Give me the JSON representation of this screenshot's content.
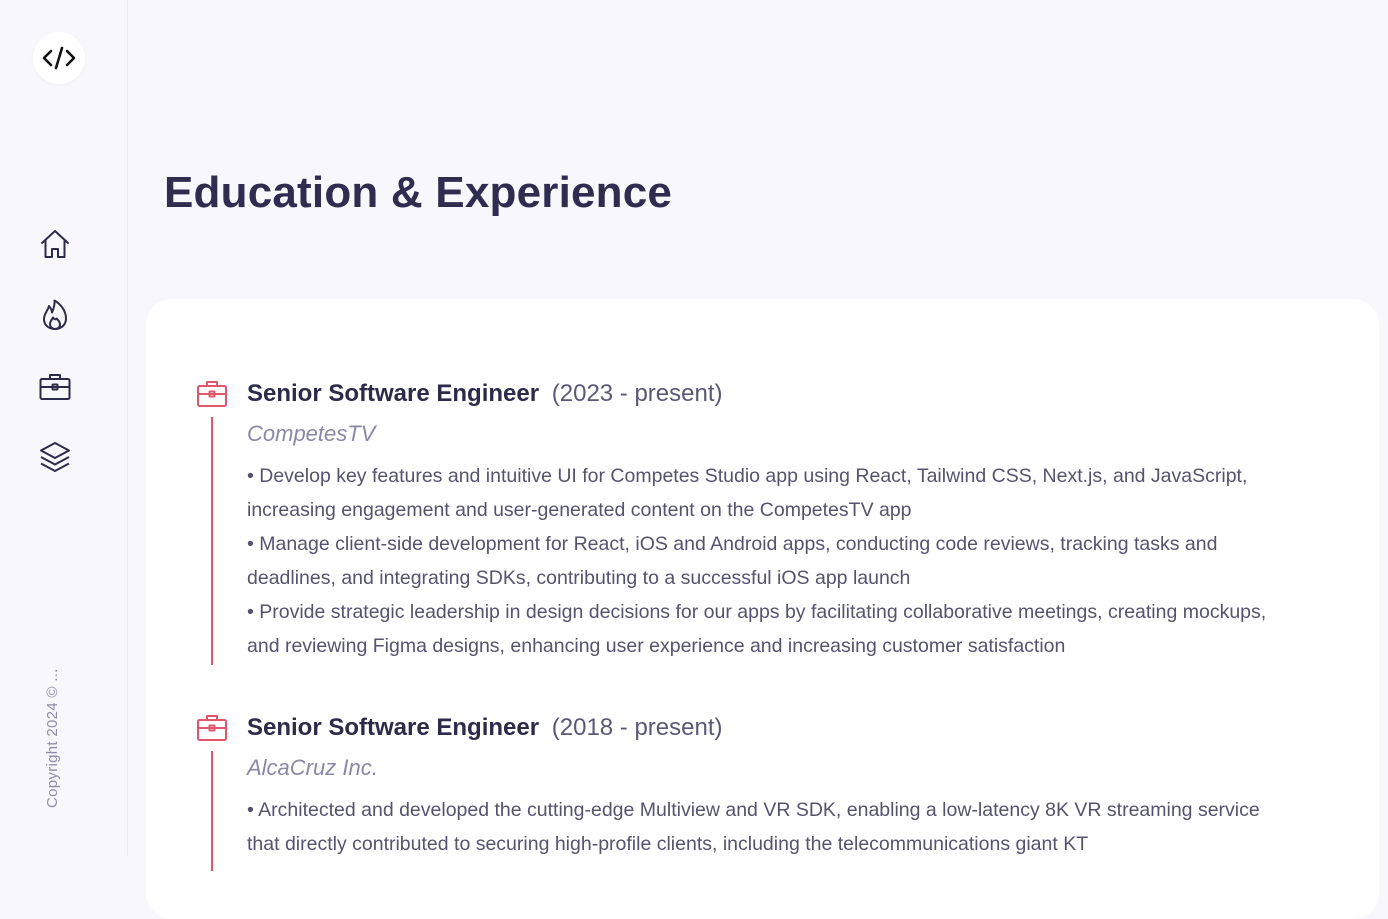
{
  "sidebar": {
    "logo_icon": "code-brackets-icon",
    "nav": [
      {
        "name": "home",
        "icon": "home-icon"
      },
      {
        "name": "flame",
        "icon": "flame-icon"
      },
      {
        "name": "briefcase",
        "icon": "briefcase-icon"
      },
      {
        "name": "layers",
        "icon": "layers-icon"
      }
    ],
    "copyright": "Copyright 2024 © ..."
  },
  "page": {
    "title": "Education & Experience"
  },
  "colors": {
    "accent": "#e0566a",
    "title": "#2f2c4f",
    "muted": "#8a88a6",
    "background": "#f8f7fc",
    "card": "#ffffff"
  },
  "experience": [
    {
      "role": "Senior Software Engineer",
      "period": "(2023 - present)",
      "company": "CompetesTV",
      "bullets": [
        "• Develop key features and intuitive UI for Competes Studio app using React, Tailwind CSS, Next.js, and JavaScript, increasing engagement and user-generated content on the CompetesTV app",
        "• Manage client-side development for React, iOS and Android apps, conducting code reviews, tracking tasks and deadlines, and integrating SDKs, contributing to a successful iOS app launch",
        "• Provide strategic leadership in design decisions for our apps by facilitating collaborative meetings, creating mockups, and reviewing Figma designs, enhancing user experience and increasing customer satisfaction"
      ]
    },
    {
      "role": "Senior Software Engineer",
      "period": "(2018 - present)",
      "company": "AlcaCruz Inc.",
      "bullets": [
        "• Architected and developed the cutting-edge Multiview and VR SDK, enabling a low-latency 8K VR streaming service that directly contributed to securing high-profile clients, including the telecommunications giant KT"
      ]
    }
  ]
}
